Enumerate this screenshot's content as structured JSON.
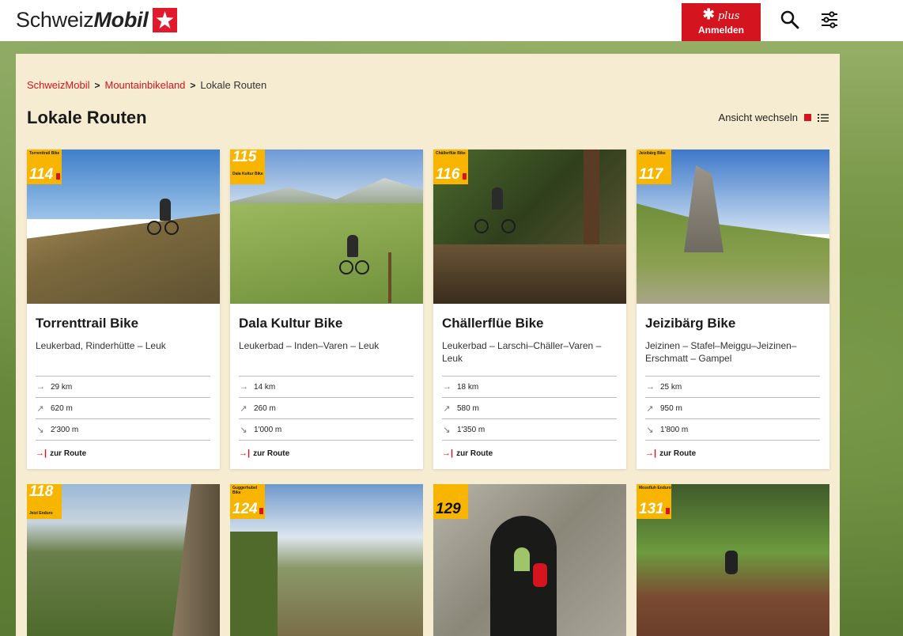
{
  "header": {
    "brand_regular": "Schweiz",
    "brand_bold": "Mobil",
    "plus_label": "plus",
    "login_label": "Anmelden"
  },
  "breadcrumb": {
    "items": [
      "SchweizMobil",
      "Mountainbikeland"
    ],
    "current": "Lokale Routen"
  },
  "page": {
    "title": "Lokale Routen",
    "view_switch_label": "Ansicht wechseln"
  },
  "route_link_label": "zur Route",
  "routes": [
    {
      "number": "114",
      "badge_label": "Torrenttrail Bike",
      "title": "Torrenttrail Bike",
      "subtitle": "Leukerbad, Rinderhütte – Leuk",
      "distance": "29 km",
      "ascent": "620 m",
      "descent": "2'300 m"
    },
    {
      "number": "115",
      "badge_label": "Dala Kultur Bike",
      "title": "Dala Kultur Bike",
      "subtitle": "Leukerbad – Inden–Varen – Leuk",
      "distance": "14 km",
      "ascent": "260 m",
      "descent": "1'000 m"
    },
    {
      "number": "116",
      "badge_label": "Chällerflüe Bike",
      "title": "Chällerflüe Bike",
      "subtitle": "Leukerbad – Larschi–Chäller–Varen – Leuk",
      "distance": "18 km",
      "ascent": "580 m",
      "descent": "1'350 m"
    },
    {
      "number": "117",
      "badge_label": "Jeizibärg Bike",
      "title": "Jeizibärg Bike",
      "subtitle": "Jeizinen – Stafel–Meiggu–Jeizinen–Erschmatt – Gampel",
      "distance": "25 km",
      "ascent": "950 m",
      "descent": "1'800 m"
    }
  ],
  "routes_row2": [
    {
      "number": "118",
      "badge_label": "Jeizi Enduro"
    },
    {
      "number": "124",
      "badge_label": "Guggerhubel Bike"
    },
    {
      "number": "129",
      "badge_label": ""
    },
    {
      "number": "131",
      "badge_label": "Mossfluh Enduro"
    }
  ],
  "colors": {
    "accent": "#d4141f",
    "panel": "#f6ecd1",
    "badge": "#f8b500"
  },
  "icons": {
    "distance": "arrow-right-icon",
    "ascent": "arrow-up-right-icon",
    "descent": "arrow-down-right-icon",
    "route": "route-arrow-icon"
  }
}
